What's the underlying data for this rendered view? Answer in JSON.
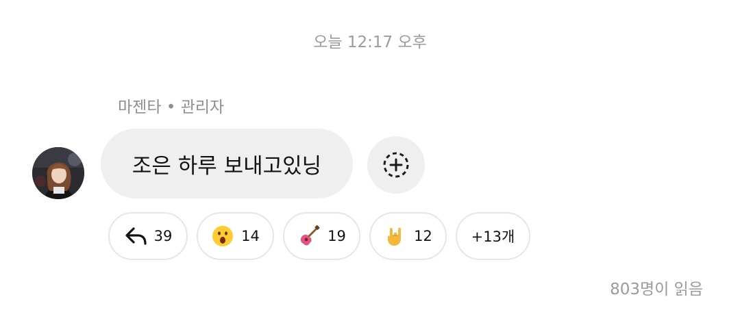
{
  "timestamp": "오늘 12:17 오후",
  "sender": {
    "name": "마젠타",
    "separator": " • ",
    "role": "관리자"
  },
  "message": {
    "text": "조은 하루 보내고있닝"
  },
  "add_reaction": {
    "icon": "add-reaction-icon"
  },
  "reactions": [
    {
      "icon": "reply-arrow-icon",
      "count": "39"
    },
    {
      "icon": "surprised-face-icon",
      "count": "14"
    },
    {
      "icon": "guitar-icon",
      "count": "19"
    },
    {
      "icon": "rock-hand-icon",
      "count": "12"
    }
  ],
  "more_reactions": "+13개",
  "read_count": "803명이 읽음",
  "colors": {
    "bubble_bg": "#efefef",
    "muted_text": "#9a9a9a",
    "chip_border": "#e6e6e6"
  }
}
